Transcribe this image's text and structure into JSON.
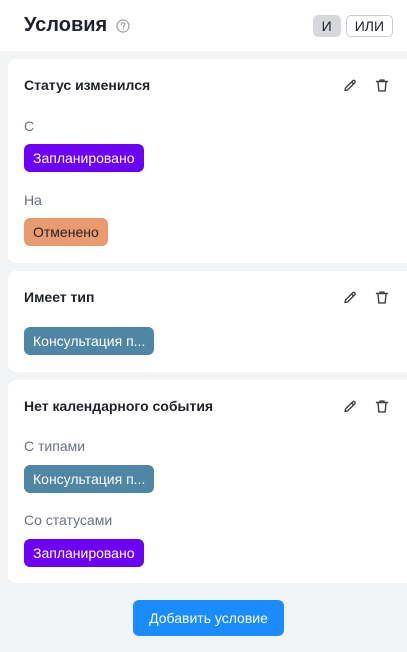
{
  "header": {
    "title": "Условия",
    "help_icon": "question-circle-icon",
    "logic": {
      "and_label": "И",
      "or_label": "ИЛИ",
      "selected": "И"
    }
  },
  "conditions": [
    {
      "title": "Статус изменился",
      "edit_icon": "pencil-icon",
      "delete_icon": "trash-icon",
      "fields": [
        {
          "label": "С",
          "tag": "Запланировано",
          "tag_color": "#6b00f5"
        },
        {
          "label": "На",
          "tag": "Отменено",
          "tag_color": "#ea9a6f"
        }
      ]
    },
    {
      "title": "Имеет тип",
      "edit_icon": "pencil-icon",
      "delete_icon": "trash-icon",
      "fields": [
        {
          "label": "",
          "tag": "Консультация п...",
          "tag_color": "#4e86a4"
        }
      ]
    },
    {
      "title": "Нет календарного события",
      "edit_icon": "pencil-icon",
      "delete_icon": "trash-icon",
      "fields": [
        {
          "label": "С типами",
          "tag": "Консультация п...",
          "tag_color": "#4e86a4"
        },
        {
          "label": "Со статусами",
          "tag": "Запланировано",
          "tag_color": "#6b00f5"
        }
      ]
    }
  ],
  "add_button_label": "Добавить условие",
  "colors": {
    "primary": "#1a8cff",
    "background": "#f2f3f5"
  }
}
